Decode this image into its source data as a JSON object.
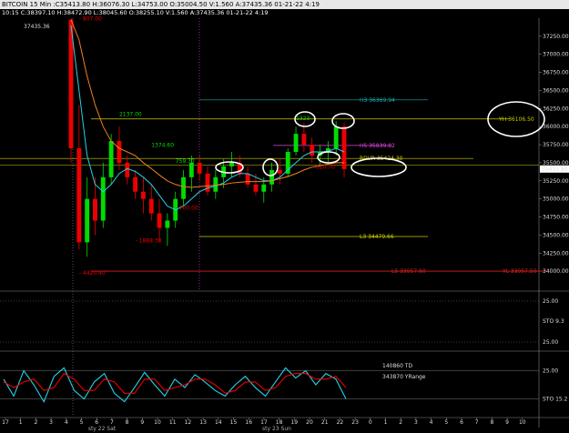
{
  "window": {
    "title": "BITCOIN  15 Min :C35413.80 H:36076.30 L:34753.00 O:35004.50 V:1.560 A:37435.36 01-21-22  4:19",
    "quote": "10:15  C:38397.10 H:38472.90 L:38045.60 O:38255.10 V:1.560 A:37435.36 01-21-22  4:19"
  },
  "colors": {
    "background": "#000000",
    "up_candle": "#00dd00",
    "down_candle": "#ee0000",
    "ma_fast": "#22d3e8",
    "ma_slow": "#f08020",
    "level_yellow": "#cccc00",
    "level_magenta": "#dd44dd",
    "level_teal": "#1aa9a9",
    "level_red": "#dd2020",
    "level_orange": "#ff9900"
  },
  "chart_data": [
    {
      "type": "candlestick",
      "title": "BITCOIN 15 Min",
      "ylim": [
        33750,
        37500
      ],
      "y_ticks": [
        "37250.00",
        "37000.00",
        "36750.00",
        "36500.00",
        "36250.00",
        "36000.00",
        "35750.00",
        "35500.00",
        "35250.00",
        "35000.00",
        "34750.00",
        "34500.00",
        "34250.00",
        "34000.00"
      ],
      "last_price_label": "35413.80",
      "top_left_label": "37435.36",
      "x_hours": [
        "17",
        "1",
        "2",
        "3",
        "4",
        "5",
        "6",
        "7",
        "8",
        "9",
        "10",
        "11",
        "12",
        "13",
        "14",
        "15",
        "16",
        "17",
        "18",
        "19",
        "20",
        "21",
        "22",
        "23",
        "0",
        "1",
        "2",
        "3",
        "4",
        "5",
        "6",
        "7",
        "8",
        "9",
        "10"
      ],
      "date_labels": [
        "sty 22 Sat",
        "sty 23 Sun"
      ],
      "ohlc": [
        [
          37480,
          37500,
          35500,
          35700
        ],
        [
          35700,
          36300,
          34300,
          34400
        ],
        [
          34400,
          35300,
          34200,
          35000
        ],
        [
          35000,
          35300,
          34500,
          34700
        ],
        [
          34700,
          35500,
          34600,
          35300
        ],
        [
          35300,
          35900,
          35200,
          35800
        ],
        [
          35800,
          36000,
          35400,
          35500
        ],
        [
          35500,
          35600,
          35200,
          35300
        ],
        [
          35300,
          35400,
          35000,
          35100
        ],
        [
          35100,
          35300,
          34800,
          35000
        ],
        [
          35000,
          35200,
          34700,
          34800
        ],
        [
          34800,
          35000,
          34400,
          34600
        ],
        [
          34600,
          34800,
          34350,
          34700
        ],
        [
          34700,
          35100,
          34600,
          35000
        ],
        [
          35000,
          35400,
          34900,
          35300
        ],
        [
          35300,
          35600,
          35100,
          35500
        ],
        [
          35500,
          35600,
          35250,
          35350
        ],
        [
          35350,
          35450,
          35050,
          35100
        ],
        [
          35100,
          35400,
          35000,
          35300
        ],
        [
          35300,
          35550,
          35150,
          35450
        ],
        [
          35450,
          35650,
          35300,
          35500
        ],
        [
          35500,
          35600,
          35300,
          35350
        ],
        [
          35350,
          35450,
          35150,
          35200
        ],
        [
          35200,
          35350,
          35050,
          35100
        ],
        [
          35100,
          35300,
          34950,
          35200
        ],
        [
          35200,
          35500,
          35100,
          35400
        ],
        [
          35400,
          35550,
          35200,
          35350
        ],
        [
          35350,
          35700,
          35300,
          35650
        ],
        [
          35650,
          36000,
          35600,
          35900
        ],
        [
          35900,
          36050,
          35650,
          35750
        ],
        [
          35750,
          35850,
          35500,
          35600
        ],
        [
          35600,
          35750,
          35450,
          35650
        ],
        [
          35650,
          35800,
          35500,
          35700
        ],
        [
          35700,
          36076,
          35600,
          36000
        ],
        [
          36000,
          36050,
          35300,
          35413
        ]
      ],
      "series": [
        {
          "name": "MA fast",
          "values": [
            37400,
            36500,
            35600,
            35200,
            35100,
            35200,
            35350,
            35420,
            35380,
            35300,
            35200,
            35050,
            34900,
            34850,
            34900,
            35000,
            35100,
            35150,
            35180,
            35220,
            35300,
            35350,
            35350,
            35300,
            35250,
            35250,
            35300,
            35400,
            35500,
            35600,
            35650,
            35650,
            35660,
            35700,
            35650
          ]
        },
        {
          "name": "MA slow",
          "values": [
            37480,
            37200,
            36700,
            36300,
            36000,
            35800,
            35700,
            35650,
            35600,
            35500,
            35420,
            35330,
            35250,
            35200,
            35170,
            35160,
            35170,
            35180,
            35190,
            35200,
            35220,
            35230,
            35240,
            35240,
            35240,
            35250,
            35280,
            35310,
            35350,
            35400,
            35440,
            35460,
            35480,
            35500,
            35500
          ]
        }
      ],
      "levels": [
        {
          "label": "H3  36369.94",
          "value": 36370,
          "color": "#1aa9a9"
        },
        {
          "label": "YH  36106.50",
          "value": 36106,
          "color": "#cccc00"
        },
        {
          "label": "H5  35839.82",
          "value": 35740,
          "color": "#dd44dd"
        },
        {
          "label": "RDVR  35424.30",
          "value": 35560,
          "color": "#cccc00"
        },
        {
          "label": "L3  34479.66",
          "value": 34480,
          "color": "#cccc00"
        },
        {
          "label": "L5  33957.60",
          "value": 34000,
          "color": "#dd2020"
        },
        {
          "label": "YL  33957.50",
          "value": 34000,
          "color": "#dd2020"
        }
      ],
      "annotations": [
        {
          "text": "2137.00",
          "x": 6,
          "y": 36150,
          "color": "#00dd00"
        },
        {
          "text": "1374.60",
          "x": 10,
          "y": 35720,
          "color": "#00dd00"
        },
        {
          "text": "759.70",
          "x": 13,
          "y": 35500,
          "color": "#00dd00"
        },
        {
          "text": "1323",
          "x": 28,
          "y": 36090,
          "color": "#00dd00"
        },
        {
          "text": "- 700.00",
          "x": 13,
          "y": 34850,
          "color": "#ee0000"
        },
        {
          "text": "- 1888.30",
          "x": 8,
          "y": 34400,
          "color": "#ee0000"
        },
        {
          "text": "- 610.70",
          "x": 30,
          "y": 35420,
          "color": "#ee0000"
        },
        {
          "text": "- 4420.40",
          "x": 1,
          "y": 33950,
          "color": "#ee0000"
        },
        {
          "text": "- 807.00",
          "x": 1,
          "y": 37470,
          "color": "#ee0000"
        }
      ]
    },
    {
      "type": "line",
      "title": "STO",
      "y_ticks": [
        "25.00",
        "STO  9.3",
        "25.00"
      ],
      "values": []
    },
    {
      "type": "line",
      "title": "STO 15.2",
      "y_ticks": [
        "25.00",
        "STO  15.2"
      ],
      "series": [
        {
          "name": "cyan",
          "values": [
            60,
            30,
            75,
            50,
            20,
            65,
            80,
            40,
            25,
            55,
            70,
            35,
            20,
            45,
            72,
            50,
            30,
            60,
            45,
            68,
            55,
            40,
            30,
            50,
            65,
            45,
            30,
            55,
            80,
            62,
            75,
            50,
            70,
            60,
            25
          ]
        },
        {
          "name": "red",
          "values": [
            55,
            45,
            55,
            60,
            40,
            45,
            70,
            60,
            40,
            40,
            60,
            55,
            35,
            35,
            60,
            60,
            40,
            45,
            50,
            60,
            60,
            50,
            35,
            40,
            55,
            55,
            40,
            45,
            65,
            70,
            70,
            60,
            60,
            65,
            45
          ]
        }
      ],
      "text_labels": [
        {
          "text": "140860 TD",
          "color": "#ff9900"
        },
        {
          "text": "343870 YRange",
          "color": "#ffffff"
        }
      ]
    }
  ]
}
